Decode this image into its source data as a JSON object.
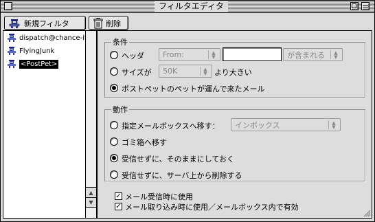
{
  "window": {
    "title": "フィルタエディタ"
  },
  "toolbar": {
    "new_filter_label": "新規フィルタ",
    "delete_label": "削除"
  },
  "filters": [
    {
      "name": "dispatch@chance-it.co",
      "selected": false
    },
    {
      "name": "FlyingJunk",
      "selected": false
    },
    {
      "name": "<PostPet>",
      "selected": true
    }
  ],
  "conditions": {
    "label": "条件",
    "header_option": {
      "label": "ヘッダ",
      "selected": false,
      "field_select": "From:",
      "value": "",
      "match_select": "が含まれる"
    },
    "size_option": {
      "label": "サイズが",
      "selected": false,
      "size_select": "50K",
      "suffix": "より大きい"
    },
    "postpet_option": {
      "label": "ポストペットのペットが運んで来たメール",
      "selected": true
    }
  },
  "actions": {
    "label": "動作",
    "move_option": {
      "label": "指定メールボックスへ移す：",
      "selected": false,
      "mailbox_select": "インボックス"
    },
    "trash_option": {
      "label": "ゴミ箱へ移す",
      "selected": false
    },
    "keep_option": {
      "label": "受信せずに、そのままにしておく",
      "selected": true
    },
    "delete_option": {
      "label": "受信せずに、サーバ上から削除する",
      "selected": false
    }
  },
  "options": {
    "use_on_receive": {
      "label": "メール受信時に使用",
      "checked": true
    },
    "use_on_import": {
      "label": "メール取り込み時に使用／メールボックス内で有効",
      "checked": true
    }
  }
}
